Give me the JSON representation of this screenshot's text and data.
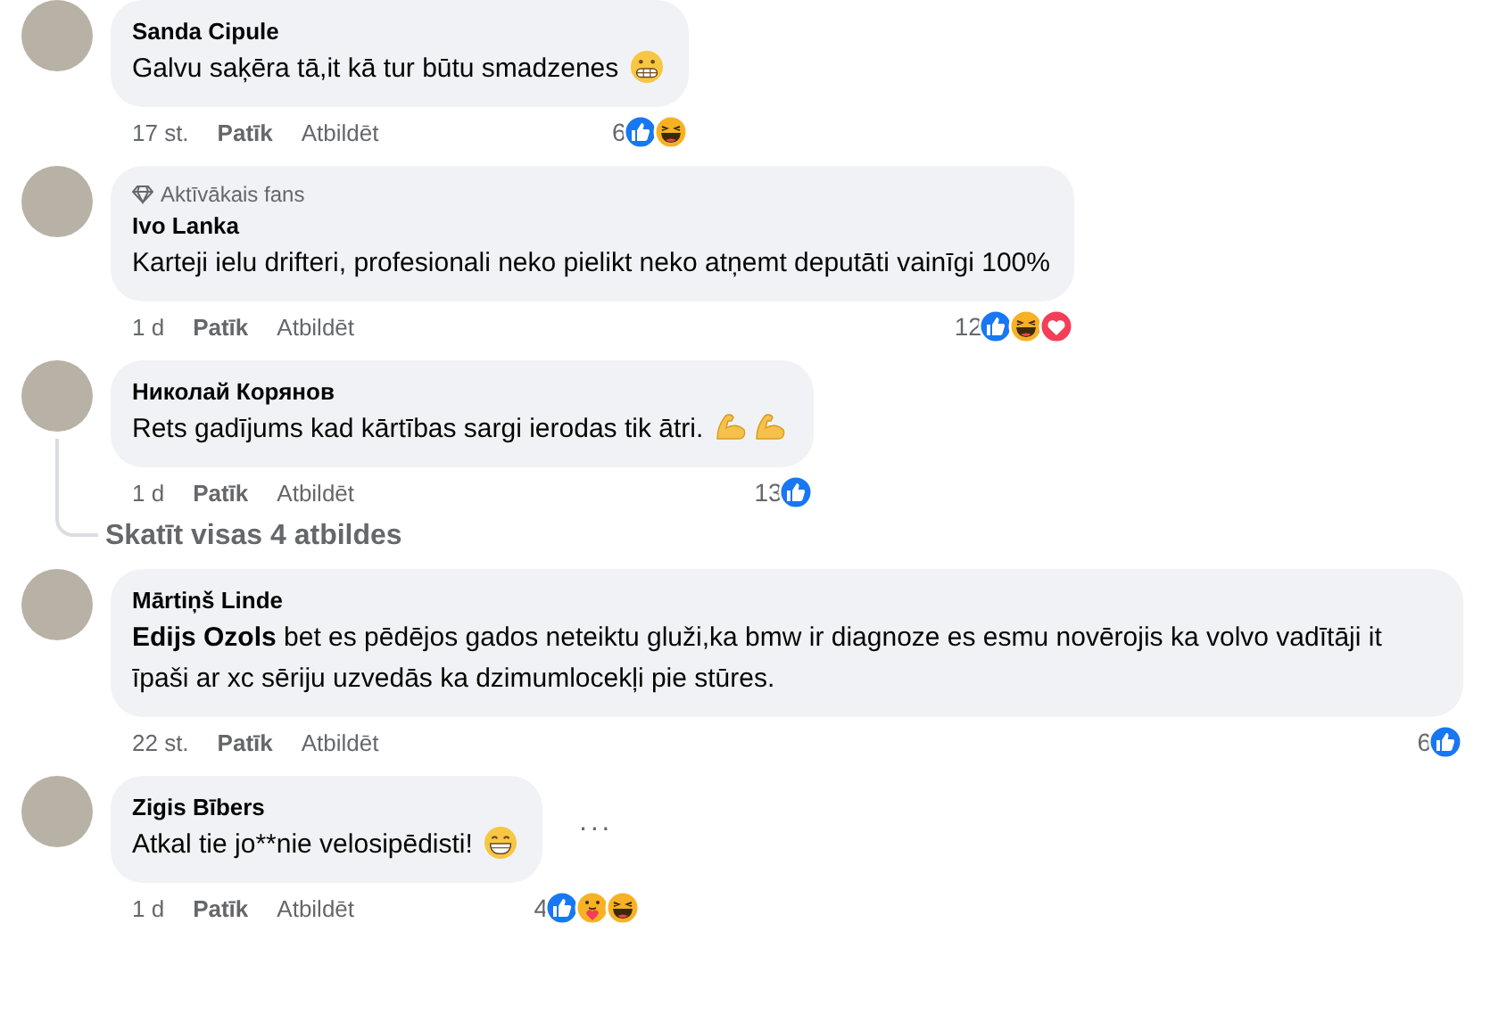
{
  "comments": [
    {
      "author": "Sanda Cipule",
      "text": "Galvu saķēra tā,it kā tur būtu smadzenes",
      "emojis": [
        {
          "kind": "grimace"
        }
      ],
      "time": "17 st.",
      "like_label": "Patīk",
      "reply_label": "Atbildēt",
      "reaction_count": "6",
      "reactions": [
        {
          "kind": "like"
        },
        {
          "kind": "haha"
        }
      ]
    },
    {
      "author": "Ivo Lanka",
      "badge": "Aktīvākais fans",
      "text": "Karteji ielu drifteri, profesionali neko pielikt neko atņemt deputāti vainīgi 100%",
      "time": "1 d",
      "like_label": "Patīk",
      "reply_label": "Atbildēt",
      "reaction_count": "12",
      "reactions": [
        {
          "kind": "like"
        },
        {
          "kind": "haha"
        },
        {
          "kind": "love"
        }
      ]
    },
    {
      "author": "Николай Корянов",
      "text": "Rets gadījums kad kārtības sargi ierodas tik ātri.",
      "emojis": [
        {
          "kind": "muscle"
        },
        {
          "kind": "muscle"
        }
      ],
      "time": "1 d",
      "like_label": "Patīk",
      "reply_label": "Atbildēt",
      "reaction_count": "13",
      "reactions": [
        {
          "kind": "like"
        }
      ],
      "replies_link": "Skatīt visas 4 atbildes"
    },
    {
      "author": "Mārtiņš Linde",
      "text": "**Edijs Ozols** bet es pēdējos gados neteiktu gluži,ka bmw ir diagnoze es esmu novērojis ka volvo vadītāji it īpaši ar xc sēriju uzvedās ka dzimumlocekļi pie stūres.",
      "time": "22 st.",
      "like_label": "Patīk",
      "reply_label": "Atbildēt",
      "reaction_count": "6",
      "reactions": [
        {
          "kind": "like"
        }
      ]
    },
    {
      "author": "Zigis Bībers",
      "text": "Atkal tie jo**nie velosipēdisti!",
      "emojis": [
        {
          "kind": "grin"
        }
      ],
      "time": "1 d",
      "like_label": "Patīk",
      "reply_label": "Atbildēt",
      "reaction_count": "4",
      "reactions": [
        {
          "kind": "like"
        },
        {
          "kind": "care"
        },
        {
          "kind": "haha"
        }
      ],
      "more_button": "···"
    }
  ]
}
